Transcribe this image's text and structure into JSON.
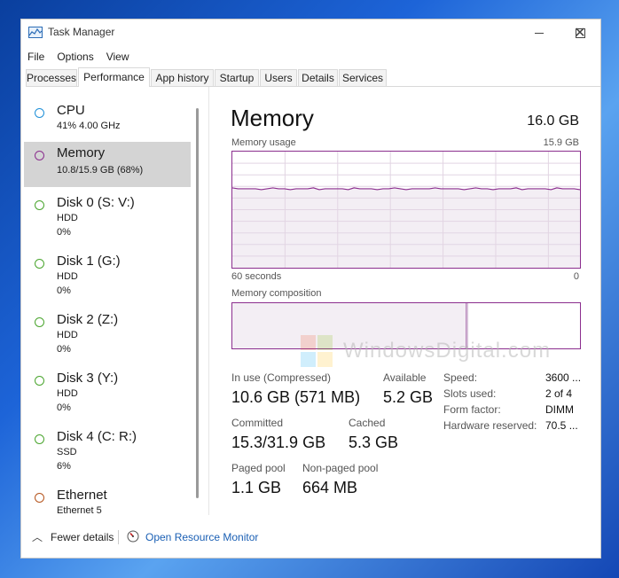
{
  "window": {
    "title": "Task Manager"
  },
  "menu": [
    "File",
    "Options",
    "View"
  ],
  "tabs": [
    "Processes",
    "Performance",
    "App history",
    "Startup",
    "Users",
    "Details",
    "Services"
  ],
  "active_tab": "Performance",
  "resources": [
    {
      "name": "CPU",
      "sub1": "41% 4.00 GHz",
      "sub2": "",
      "color": "#1e8fd8"
    },
    {
      "name": "Memory",
      "sub1": "10.8/15.9 GB (68%)",
      "sub2": "",
      "color": "#8b2e8e",
      "selected": true
    },
    {
      "name": "Disk 0 (S: V:)",
      "sub1": "HDD",
      "sub2": "0%",
      "color": "#4aa52e"
    },
    {
      "name": "Disk 1 (G:)",
      "sub1": "HDD",
      "sub2": "0%",
      "color": "#4aa52e"
    },
    {
      "name": "Disk 2 (Z:)",
      "sub1": "HDD",
      "sub2": "0%",
      "color": "#4aa52e"
    },
    {
      "name": "Disk 3 (Y:)",
      "sub1": "HDD",
      "sub2": "0%",
      "color": "#4aa52e"
    },
    {
      "name": "Disk 4 (C: R:)",
      "sub1": "SSD",
      "sub2": "6%",
      "color": "#4aa52e"
    },
    {
      "name": "Ethernet",
      "sub1": "Ethernet 5",
      "sub2": "",
      "color": "#b5541c"
    }
  ],
  "memory": {
    "title": "Memory",
    "total": "16.0 GB",
    "usage_label": "Memory usage",
    "usage_max": "15.9 GB",
    "time_left": "60 seconds",
    "time_right": "0",
    "usage_fraction": 0.68,
    "composition_label": "Memory composition",
    "in_use_label": "In use (Compressed)",
    "in_use_value": "10.6 GB (571 MB)",
    "available_label": "Available",
    "available_value": "5.2 GB",
    "committed_label": "Committed",
    "committed_value": "15.3/31.9 GB",
    "cached_label": "Cached",
    "cached_value": "5.3 GB",
    "paged_label": "Paged pool",
    "paged_value": "1.1 GB",
    "nonpaged_label": "Non-paged pool",
    "nonpaged_value": "664 MB",
    "specs": [
      {
        "label": "Speed:",
        "value": "3600 ..."
      },
      {
        "label": "Slots used:",
        "value": "2 of 4"
      },
      {
        "label": "Form factor:",
        "value": "DIMM"
      },
      {
        "label": "Hardware reserved:",
        "value": "70.5 ..."
      }
    ]
  },
  "footer": {
    "fewer_details": "Fewer details",
    "resource_monitor": "Open Resource Monitor"
  },
  "watermark": "WindowsDigital.com",
  "colors": {
    "memory_accent": "#8b2e8e",
    "link": "#1a5fb4",
    "selected_bg": "#d4d4d4"
  }
}
